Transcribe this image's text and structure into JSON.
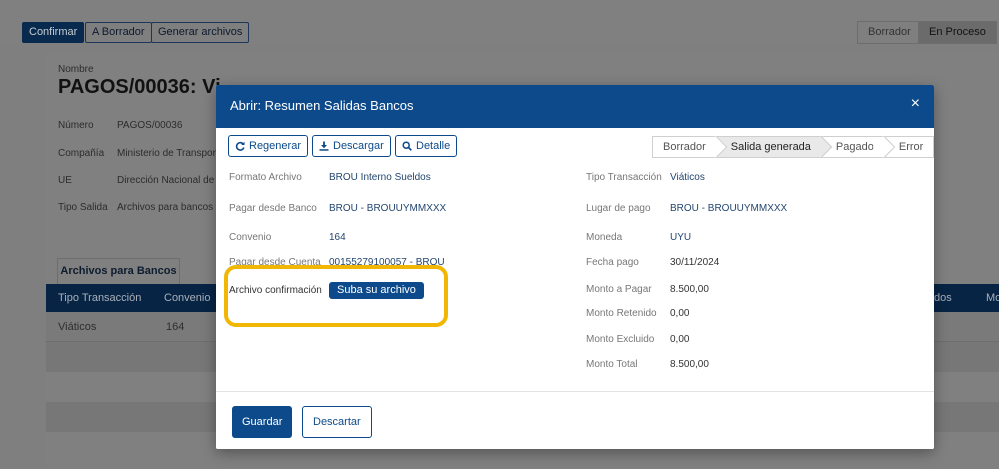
{
  "toolbar": {
    "confirm_label": "Confirmar",
    "to_draft_label": "A Borrador",
    "generate_label": "Generar archivos",
    "stages": [
      "Borrador",
      "En Proceso"
    ]
  },
  "record": {
    "name_label": "Nombre",
    "title": "PAGOS/00036: Vi",
    "fields": [
      {
        "label": "Número",
        "value": "PAGOS/00036"
      },
      {
        "label": "Compañía",
        "value": "Ministerio de Transporte"
      },
      {
        "label": "UE",
        "value": "Dirección Nacional de V"
      },
      {
        "label": "Tipo Salida",
        "value": "Archivos para bancos"
      }
    ],
    "tab_label": "Archivos para Bancos",
    "table": {
      "headers": [
        "Tipo Transacción",
        "Convenio",
        "dos",
        "Mo"
      ],
      "row": [
        "Viáticos",
        "164"
      ]
    }
  },
  "modal": {
    "title": "Abrir: Resumen Salidas Bancos",
    "close_glyph": "×",
    "buttons": {
      "regenerate": "Regenerar",
      "download": "Descargar",
      "detail": "Detalle"
    },
    "steps": [
      "Borrador",
      "Salida generada",
      "Pagado",
      "Error"
    ],
    "active_step": "Salida generada",
    "left_fields": [
      {
        "label": "Formato Archivo",
        "value": "BROU Interno Sueldos"
      },
      {
        "label": "Pagar desde Banco",
        "value": "BROU - BROUUYMMXXX"
      },
      {
        "label": "Convenio",
        "value": "164"
      },
      {
        "label": "Pagar desde Cuenta",
        "value": "00155279100057 - BROU"
      }
    ],
    "upload": {
      "label": "Archivo confirmación",
      "button": "Suba su archivo"
    },
    "right_fields": [
      {
        "label": "Tipo Transacción",
        "value": "Viáticos"
      },
      {
        "label": "Lugar de pago",
        "value": "BROU - BROUUYMMXXX"
      },
      {
        "label": "Moneda",
        "value": "UYU"
      },
      {
        "label": "Fecha pago",
        "value": "30/11/2024"
      },
      {
        "label": "Monto a Pagar",
        "value": "8.500,00"
      },
      {
        "label": "Monto Retenido",
        "value": "0,00"
      },
      {
        "label": "Monto Excluido",
        "value": "0,00"
      },
      {
        "label": "Monto Total",
        "value": "8.500,00"
      }
    ],
    "footer": {
      "save": "Guardar",
      "discard": "Descartar"
    }
  },
  "colors": {
    "primary": "#0c4a8b",
    "highlight": "#f2b705"
  }
}
